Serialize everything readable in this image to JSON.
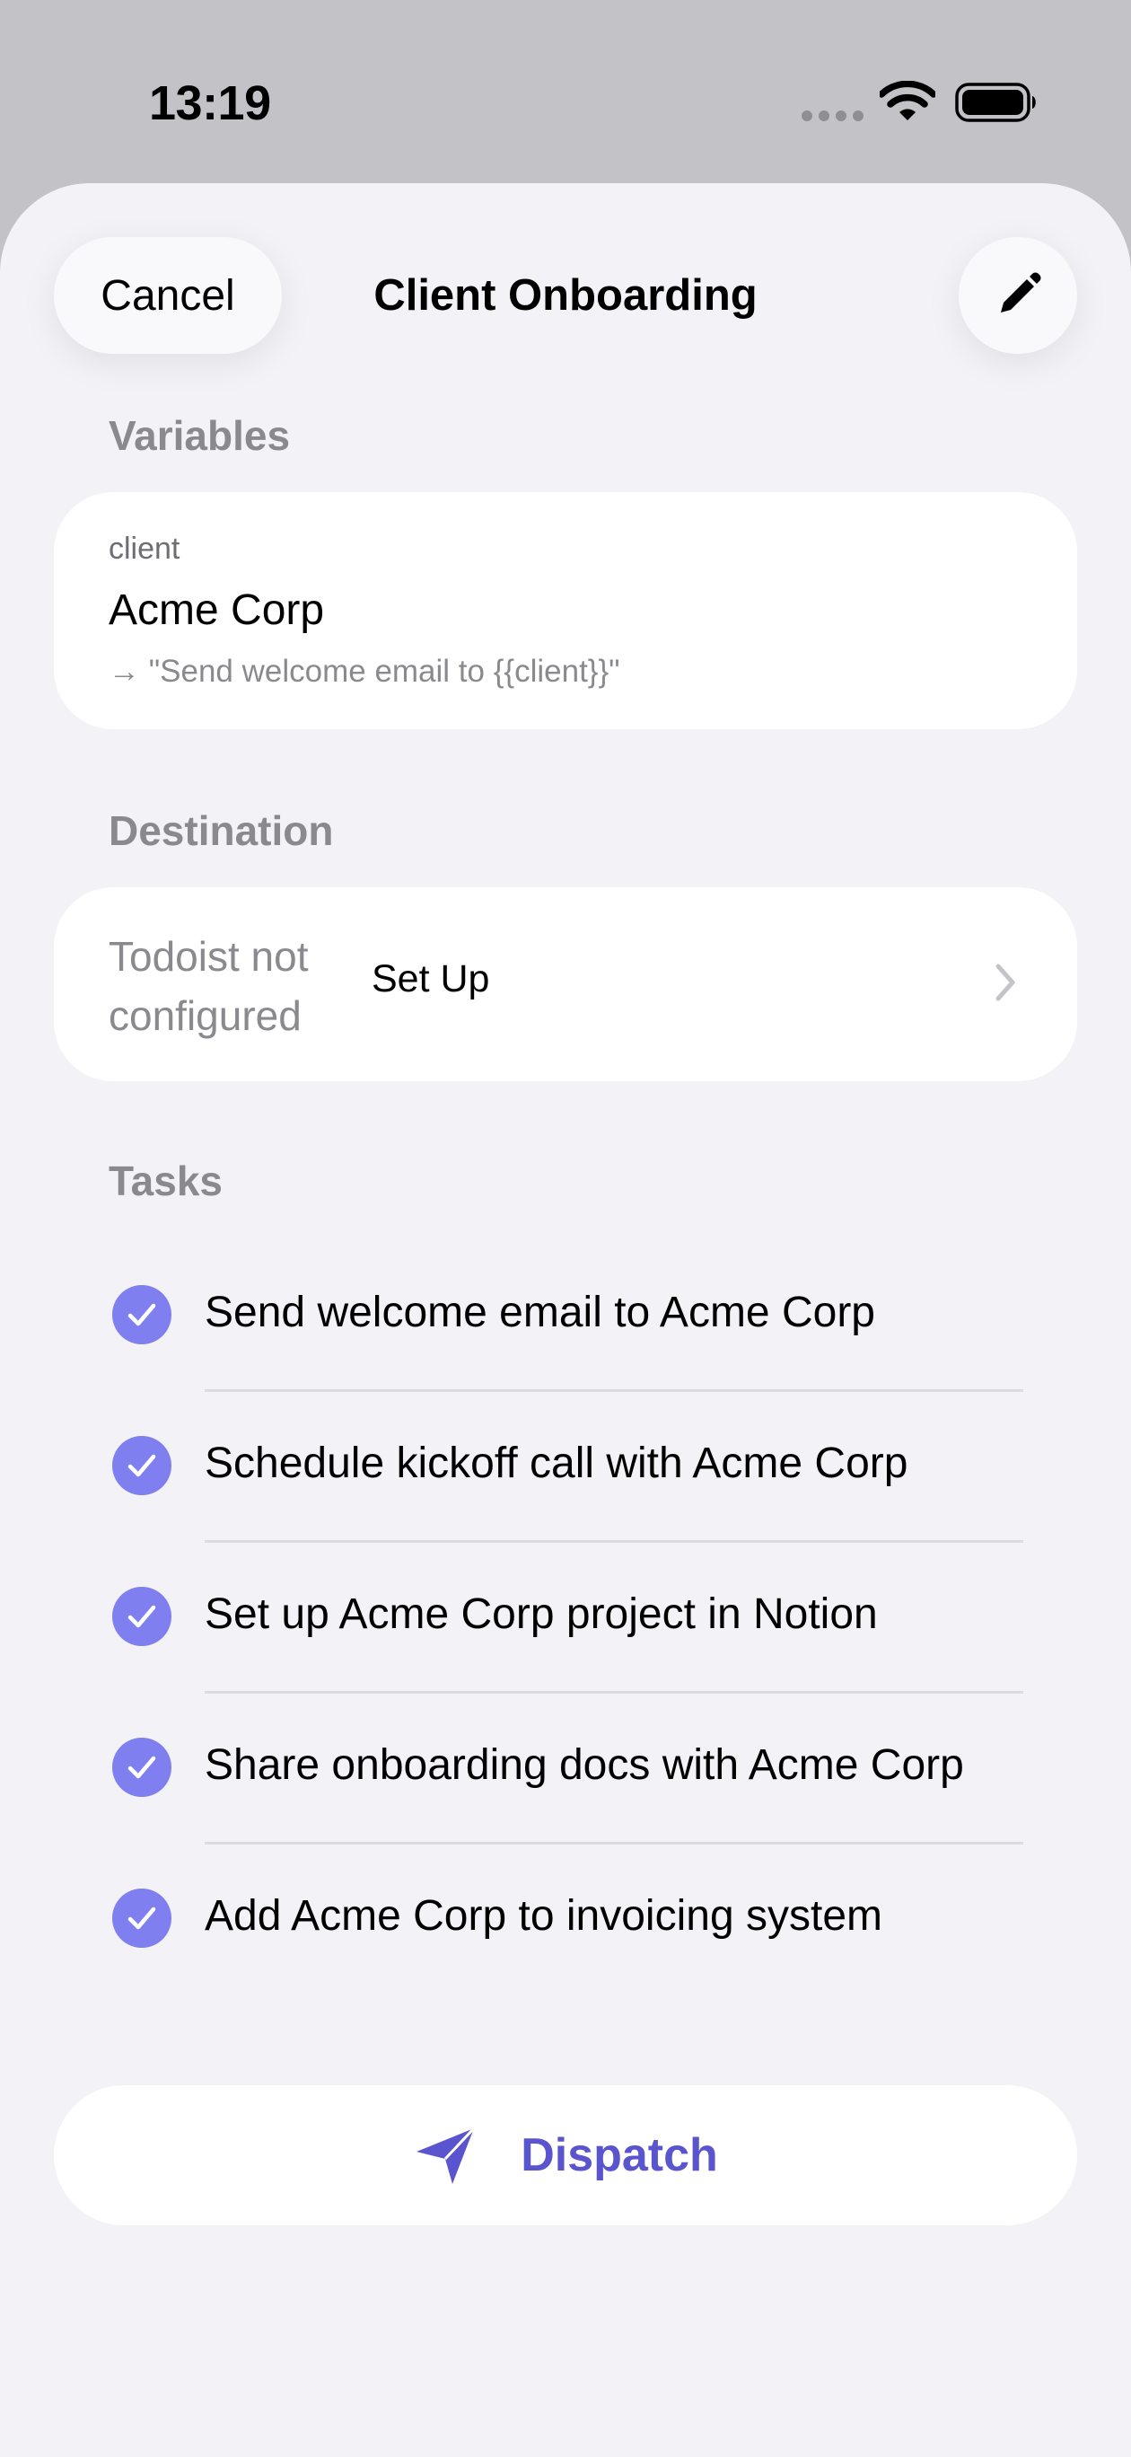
{
  "status_bar": {
    "time": "13:19",
    "signal_icon": "signal-dots-icon",
    "wifi_icon": "wifi-icon",
    "battery_icon": "battery-icon"
  },
  "nav": {
    "cancel_label": "Cancel",
    "title": "Client Onboarding",
    "edit_icon": "pencil-icon"
  },
  "variables": {
    "header": "Variables",
    "items": [
      {
        "name": "client",
        "value": "Acme Corp",
        "preview": "→ \"Send welcome email to {{client}}\""
      }
    ]
  },
  "destination": {
    "header": "Destination",
    "status": "Todoist not configured",
    "action_label": "Set Up",
    "chevron_icon": "chevron-right-icon"
  },
  "tasks": {
    "header": "Tasks",
    "items": [
      {
        "label": "Send welcome email to Acme Corp",
        "checked": true
      },
      {
        "label": "Schedule kickoff call with Acme Corp",
        "checked": true
      },
      {
        "label": "Set up Acme Corp project in Notion",
        "checked": true
      },
      {
        "label": "Share onboarding docs with Acme Corp",
        "checked": true
      },
      {
        "label": "Add Acme Corp to invoicing system",
        "checked": true
      }
    ]
  },
  "dispatch": {
    "label": "Dispatch",
    "icon": "paper-plane-icon"
  },
  "colors": {
    "accent": "#5a55cf",
    "check_fill": "#7f7ff0",
    "background": "#f2f2f7",
    "secondary_text": "#8a8a8e"
  }
}
